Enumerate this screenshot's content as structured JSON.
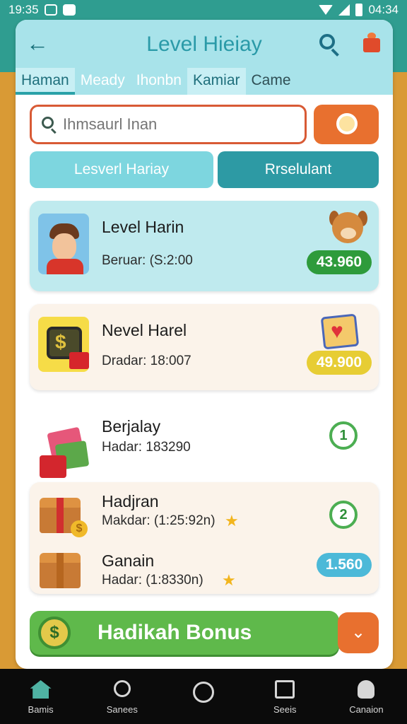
{
  "status_bar": {
    "time": "19:35",
    "right_time": "04:34"
  },
  "header": {
    "title": "Level Hieiay",
    "tabs": [
      "Haman",
      "Meady",
      "Ihonbn",
      "Kamiar",
      "Came"
    ]
  },
  "search": {
    "placeholder": "Ihmsaurl Inan"
  },
  "filters": {
    "left": "Lesverl Hariay",
    "right": "Rrselulant"
  },
  "items": [
    {
      "title": "Level Harin",
      "subtitle": "Beruar: (S:2:00",
      "badge": "43.960",
      "badge_color": "#2e9b3b"
    },
    {
      "title": "Nevel Harel",
      "subtitle": "Dradar: 18:007",
      "badge": "49.900",
      "badge_color": "#e7cd34"
    },
    {
      "title": "Berjalay",
      "subtitle": "Hadar: 183290",
      "badge": "1"
    },
    {
      "title": "Hadjran",
      "subtitle": "Makdar: (1:25:92n)",
      "badge": "2"
    },
    {
      "title": "Ganain",
      "subtitle": "Hadar: (1:8330n)",
      "badge": "1.560",
      "badge_color": "#4cb9d8"
    }
  ],
  "bonus": {
    "label": "Hadikah Bonus",
    "coin": "$"
  },
  "nav": [
    "Bamis",
    "Sanees",
    "",
    "Seeis",
    "Canaion"
  ],
  "colors": {
    "accent": "#2f9d90",
    "orange": "#e8702f",
    "green": "#5fb94b"
  }
}
